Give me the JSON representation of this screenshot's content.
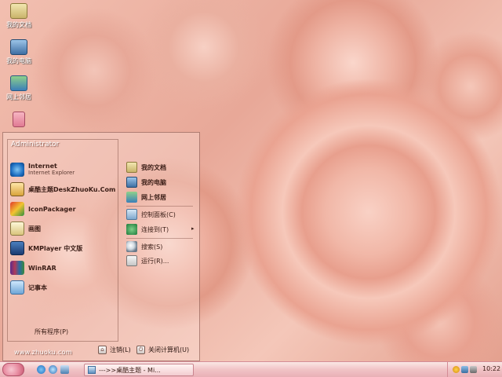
{
  "desktop": {
    "icons": [
      {
        "label": "我的文档",
        "icon": "my-documents-icon"
      },
      {
        "label": "我的电脑",
        "icon": "my-computer-icon"
      },
      {
        "label": "网上邻居",
        "icon": "network-icon"
      },
      {
        "label": "",
        "icon": "recycle-bin-icon"
      }
    ]
  },
  "start_menu": {
    "user": "Administrator",
    "programs": [
      {
        "title": "Internet",
        "subtitle": "Internet Explorer",
        "icon": "ie-icon"
      },
      {
        "title": "桌酷主题DeskZhuoKu.Com",
        "icon": "theme-icon"
      },
      {
        "title": "IconPackager",
        "icon": "iconpackager-icon"
      },
      {
        "title": "画图",
        "icon": "paint-icon"
      },
      {
        "title": "KMPlayer 中文版",
        "icon": "kmplayer-icon"
      },
      {
        "title": "WinRAR",
        "icon": "winrar-icon"
      },
      {
        "title": "记事本",
        "icon": "notepad-icon"
      }
    ],
    "places": [
      {
        "label": "我的文档",
        "icon": "my-documents-icon"
      },
      {
        "label": "我的电脑",
        "icon": "my-computer-icon"
      },
      {
        "label": "网上邻居",
        "icon": "network-icon"
      },
      {
        "label": "控制面板(C)",
        "icon": "control-panel-icon"
      },
      {
        "label": "连接到(T)",
        "icon": "connect-icon"
      },
      {
        "label": "搜索(S)",
        "icon": "search-icon"
      },
      {
        "label": "运行(R)...",
        "icon": "run-icon"
      }
    ],
    "all_programs": "所有程序(P)",
    "site": "www.zhuoku.com",
    "logoff": "注销(L)",
    "shutdown": "关闭计算机(U)"
  },
  "taskbar": {
    "task_button": "--->>桌酷主题 - Mi...",
    "clock": "10:22"
  },
  "colors": {
    "taskbar_pink": "#f1c3c6",
    "menu_border": "#7a4a40"
  }
}
